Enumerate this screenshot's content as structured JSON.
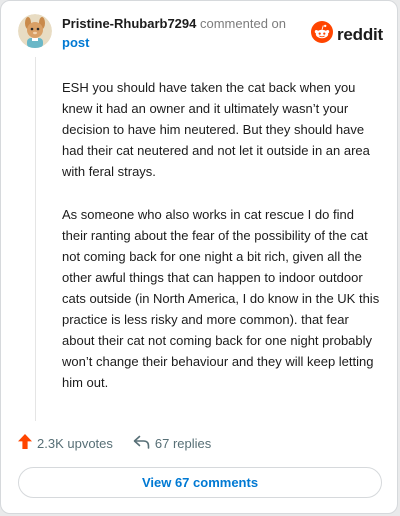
{
  "header": {
    "username": "Pristine-Rhubarb7294",
    "action_text": "commented on",
    "target": "post",
    "brand": "reddit"
  },
  "comment": {
    "paragraphs": [
      "ESH you should have taken the cat back when you knew it had an owner and it ultimately wasn’t your decision to have him neutered. But they should have had their cat neutered and not let it outside in an area with feral strays.",
      "As someone who also works in cat rescue I do find their ranting about the fear of the possibility of the cat not coming back for one night a bit rich, given all the other awful things that can happen to indoor outdoor cats outside (in North America, I do know in the UK this practice is less risky and more common). that fear about their cat not coming back for one night probably won’t change their behaviour and they will keep letting him out."
    ]
  },
  "footer": {
    "upvotes": "2.3K upvotes",
    "replies": "67 replies",
    "view_button": "View 67 comments"
  },
  "colors": {
    "reddit_orange": "#ff4500",
    "link_blue": "#0079d3",
    "meta_gray": "#576f76"
  },
  "icons": {
    "avatar": "avatar",
    "brand": "reddit-logo-icon",
    "upvote": "upvote-arrow-icon",
    "reply": "reply-arrow-icon"
  }
}
